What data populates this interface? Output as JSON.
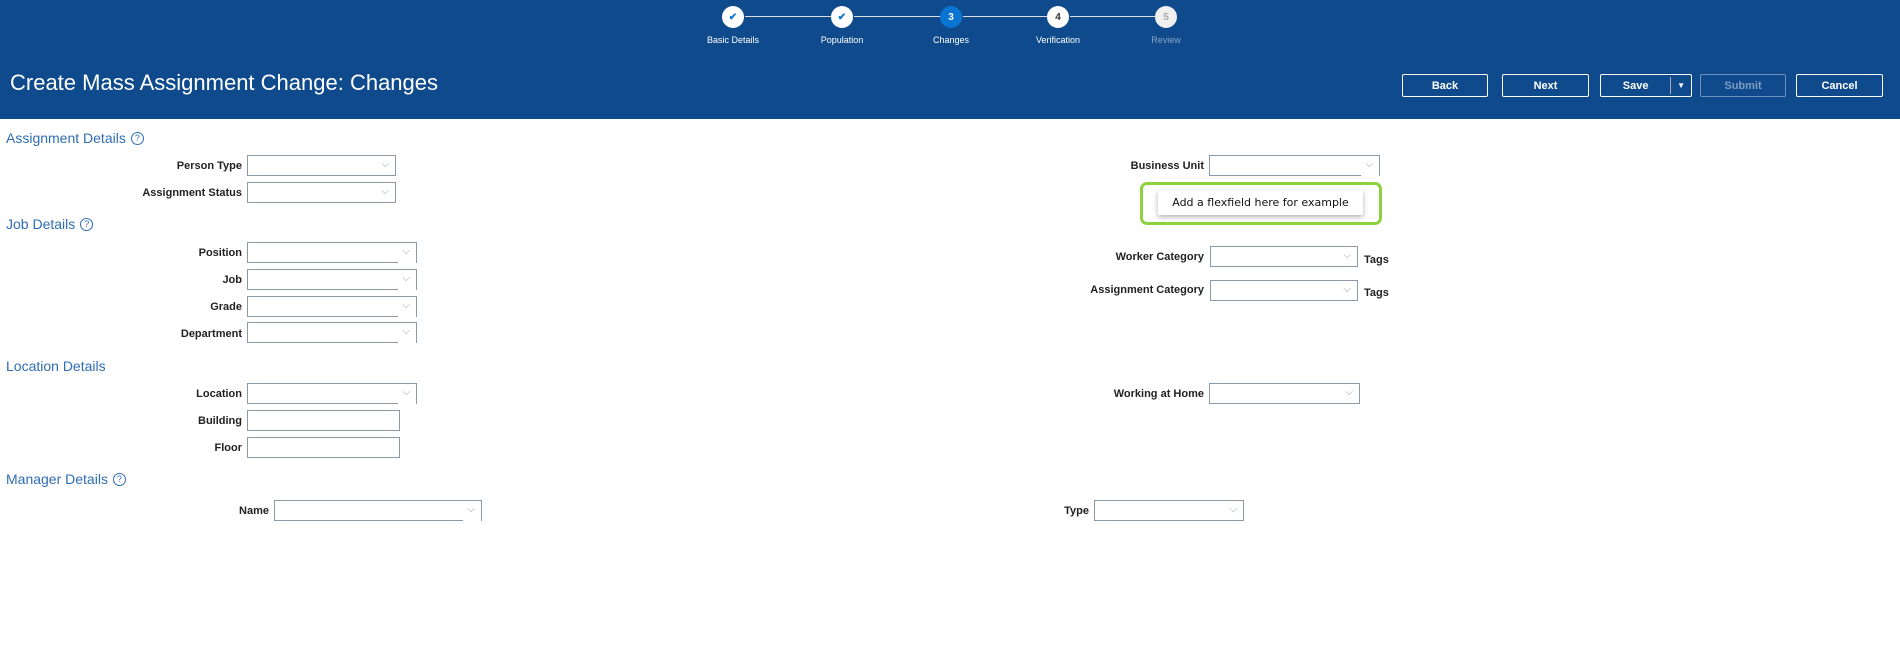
{
  "header": {
    "title": "Create Mass Assignment Change: Changes",
    "steps": [
      {
        "num": "",
        "label": "Basic Details",
        "state": "done"
      },
      {
        "num": "",
        "label": "Population",
        "state": "done"
      },
      {
        "num": "3",
        "label": "Changes",
        "state": "current"
      },
      {
        "num": "4",
        "label": "Verification",
        "state": "pending"
      },
      {
        "num": "5",
        "label": "Review",
        "state": "disabled"
      }
    ],
    "buttons": {
      "back": "Back",
      "next": "Next",
      "save": "Save",
      "submit": "Submit",
      "cancel": "Cancel"
    }
  },
  "sections": {
    "assignment": "Assignment Details",
    "job": "Job Details",
    "location": "Location Details",
    "manager": "Manager Details"
  },
  "labels": {
    "person_type": "Person Type",
    "assignment_status": "Assignment Status",
    "position": "Position",
    "job": "Job",
    "grade": "Grade",
    "department": "Department",
    "location": "Location",
    "building": "Building",
    "floor": "Floor",
    "name": "Name",
    "type": "Type",
    "business_unit": "Business Unit",
    "worker_category": "Worker Category",
    "assignment_category": "Assignment Category",
    "working_at_home": "Working at Home",
    "tags": "Tags"
  },
  "flexfield": "Add a flexfield here for example",
  "icons": {
    "help": "?",
    "chevron": "⌵",
    "check": "✔",
    "dropdown": "▼"
  }
}
